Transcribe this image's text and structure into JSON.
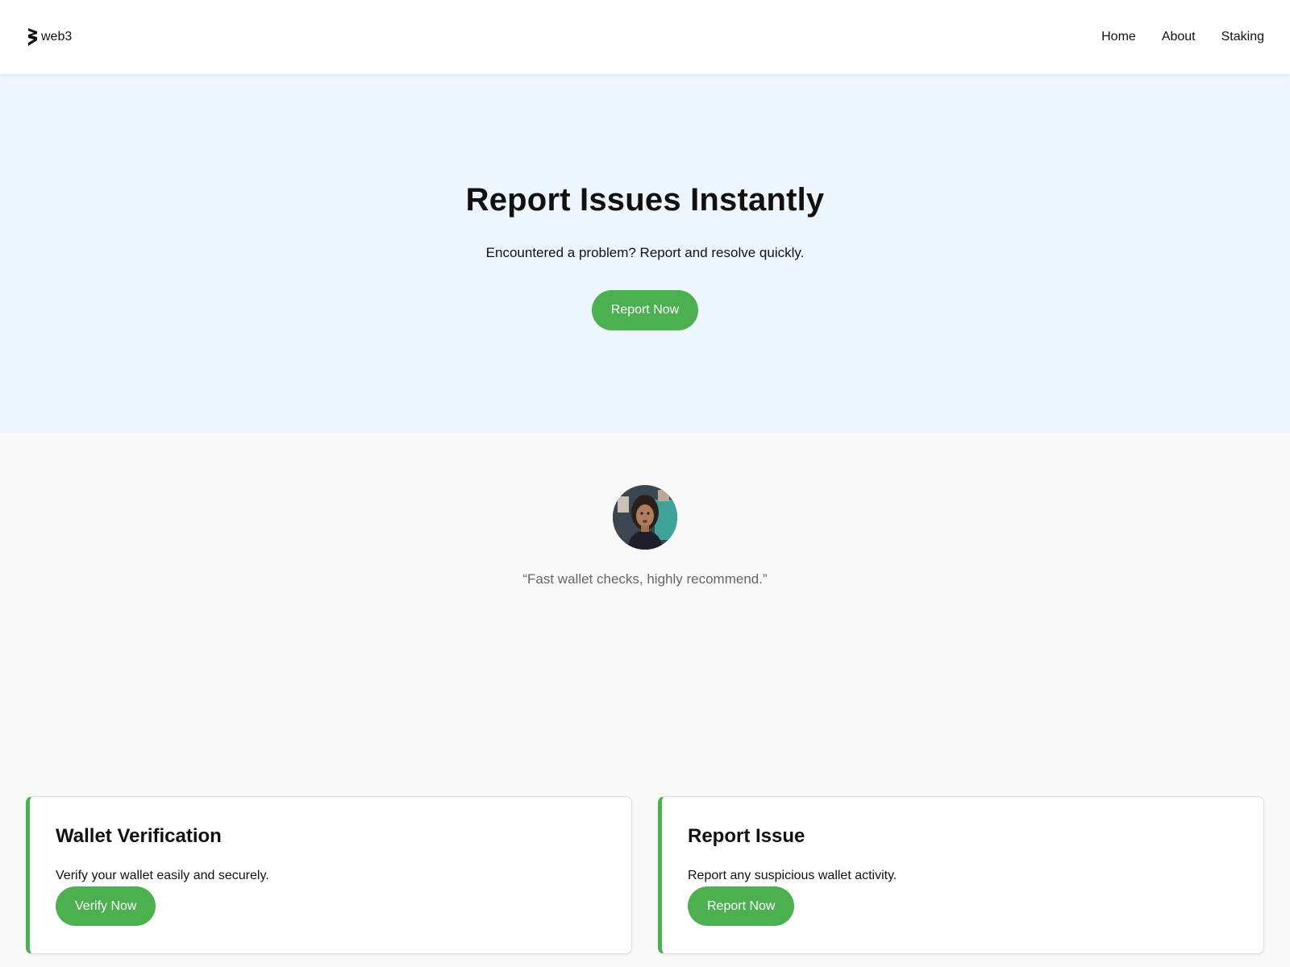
{
  "header": {
    "logo_text": "web3",
    "nav": [
      {
        "label": "Home"
      },
      {
        "label": "About"
      },
      {
        "label": "Staking"
      }
    ]
  },
  "hero": {
    "title": "Report Issues Instantly",
    "subtitle": "Encountered a problem? Report and resolve quickly.",
    "button_label": "Report Now"
  },
  "testimonial": {
    "quote": "“Fast wallet checks, highly recommend.”"
  },
  "cards": [
    {
      "title": "Wallet Verification",
      "text": "Verify your wallet easily and securely.",
      "button_label": "Verify Now"
    },
    {
      "title": "Report Issue",
      "text": "Report any suspicious wallet activity.",
      "button_label": "Report Now"
    }
  ],
  "colors": {
    "accent": "#4caf50",
    "hero_bg": "#eef6fd",
    "page_bg": "#f8f8f8",
    "quote_text": "#666666"
  },
  "icons": {
    "logo": "web3-logo-icon",
    "avatar": "user-avatar"
  }
}
